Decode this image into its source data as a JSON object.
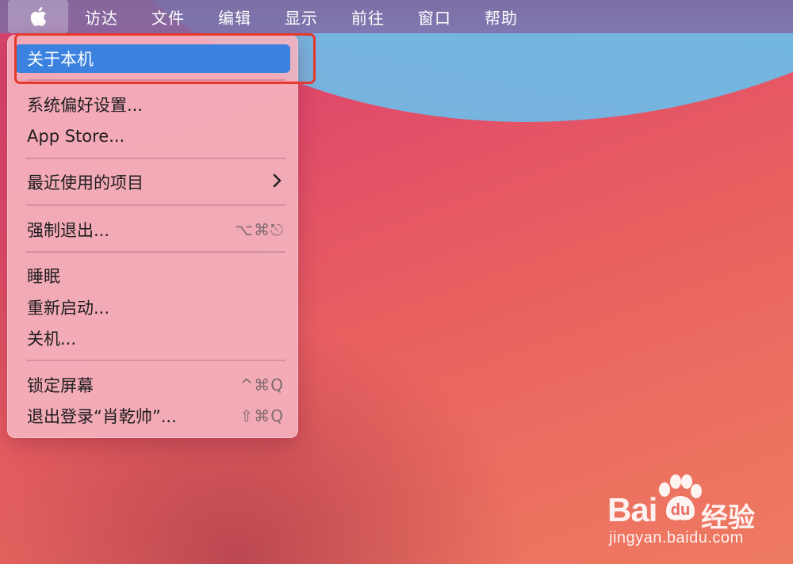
{
  "menubar": {
    "apple_icon": "apple-logo",
    "menus": [
      "访达",
      "文件",
      "编辑",
      "显示",
      "前往",
      "窗口",
      "帮助"
    ]
  },
  "apple_menu": {
    "items": {
      "about": {
        "label": "关于本机",
        "highlighted": true
      },
      "system_prefs": {
        "label": "系统偏好设置..."
      },
      "app_store": {
        "label": "App Store..."
      },
      "recent_items": {
        "label": "最近使用的项目",
        "submenu_icon": "chevron-right"
      },
      "force_quit": {
        "label": "强制退出...",
        "shortcut": "⌥⌘⎋"
      },
      "sleep": {
        "label": "睡眠"
      },
      "restart": {
        "label": "重新启动..."
      },
      "shutdown": {
        "label": "关机..."
      },
      "lock_screen": {
        "label": "锁定屏幕",
        "shortcut": "^⌘Q"
      },
      "log_out": {
        "label": "退出登录“肖乾帅”...",
        "shortcut": "⇧⌘Q"
      }
    }
  },
  "watermark": {
    "logo_text": "Bai",
    "logo_suffix": "经验",
    "url": "jingyan.baidu.com"
  },
  "colors": {
    "highlight": "#3b82e0",
    "annotation": "#e8372b"
  }
}
